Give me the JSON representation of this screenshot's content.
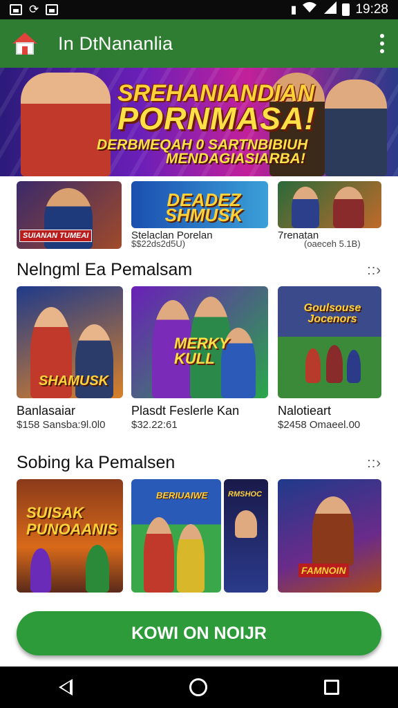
{
  "status_bar": {
    "time": "19:28"
  },
  "app_bar": {
    "title": "In DtNananlia"
  },
  "hero": {
    "line1": "SREHANIANDIAN",
    "line2": "PORNMASA!",
    "line3": "DERBMEQAH 0 SARTNBIBIUH",
    "line4": "MENDAGIASIARBA!"
  },
  "featured": [
    {
      "badge": "SUIANAN TUMEAI",
      "name": "",
      "price": ""
    },
    {
      "badge": "DEADEZ SHMUSK",
      "name": "Stelaclan Porelan",
      "price": "$$22ds2d5U)"
    },
    {
      "badge": "",
      "name": "7renatan",
      "price": "(oaeceh 5.1B)"
    }
  ],
  "section1": {
    "title": "Nelngml Ea Pemalsam",
    "more": "::›",
    "cards": [
      {
        "art_text": "SHAMUSK",
        "name": "Banlasaiar",
        "price": "$158 Sansba:9l.0l0"
      },
      {
        "art_text": "MERKY KULL",
        "name": "Plasdt Feslerle Kan",
        "price": "$32.22:61"
      },
      {
        "art_text": "Goulsouse Jocenors",
        "name": "Nalotieart",
        "price": "$2458 Omaeel.00"
      }
    ]
  },
  "section2": {
    "title": "Sobing ka Pemalsen",
    "more": "::›",
    "cards": [
      {
        "art_text": "SUISAK PUNOAANIS"
      },
      {
        "art_text": "BERIUAIWE"
      },
      {
        "art_text": "RMSHOC"
      },
      {
        "art_text": "FAMNOIN"
      }
    ]
  },
  "cta": {
    "label": "KOWI ON NOIJR"
  },
  "colors": {
    "primary": "#2e7d32",
    "cta": "#2e9b3a"
  }
}
